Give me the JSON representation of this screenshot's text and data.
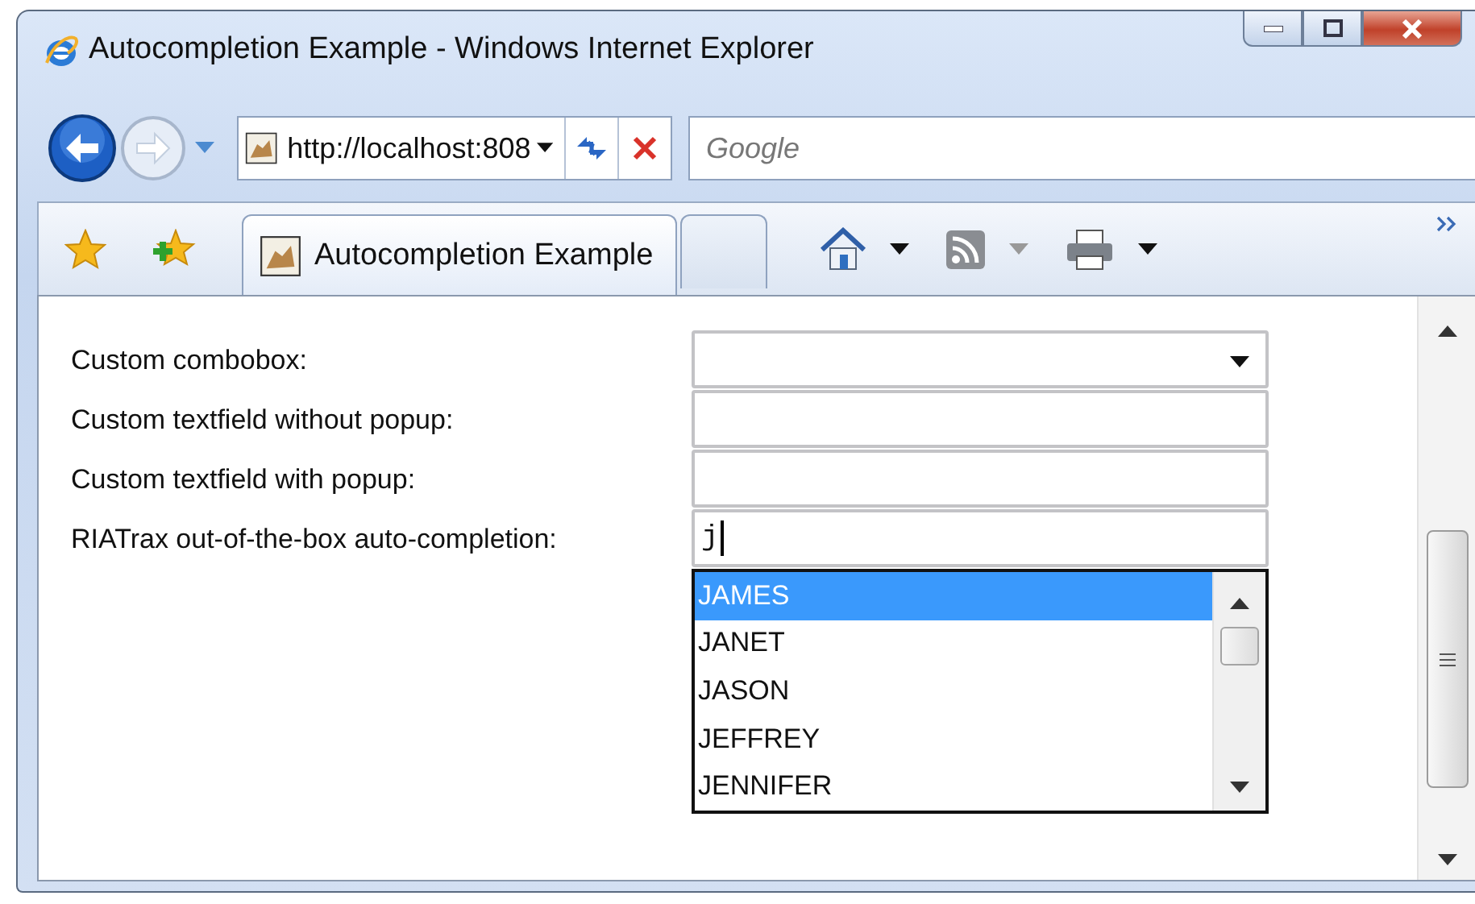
{
  "window": {
    "title": "Autocompletion Example - Windows Internet Explorer"
  },
  "address_bar": {
    "value": "http://localhost:808"
  },
  "search": {
    "placeholder": "Google"
  },
  "tabs": [
    {
      "label": "Autocompletion Example",
      "selected": true
    }
  ],
  "form": {
    "rows": [
      {
        "label": "Custom combobox:",
        "kind": "combo"
      },
      {
        "label": "Custom textfield without popup:",
        "kind": "text"
      },
      {
        "label": "Custom textfield with popup:",
        "kind": "text"
      },
      {
        "label": "RIATrax out-of-the-box auto-completion:",
        "kind": "text",
        "value": "j",
        "focused": true
      }
    ]
  },
  "suggestions": [
    {
      "label": "JAMES",
      "selected": true
    },
    {
      "label": "JANET",
      "selected": false
    },
    {
      "label": "JASON",
      "selected": false
    },
    {
      "label": "JEFFREY",
      "selected": false
    },
    {
      "label": "JENNIFER",
      "selected": false
    }
  ]
}
